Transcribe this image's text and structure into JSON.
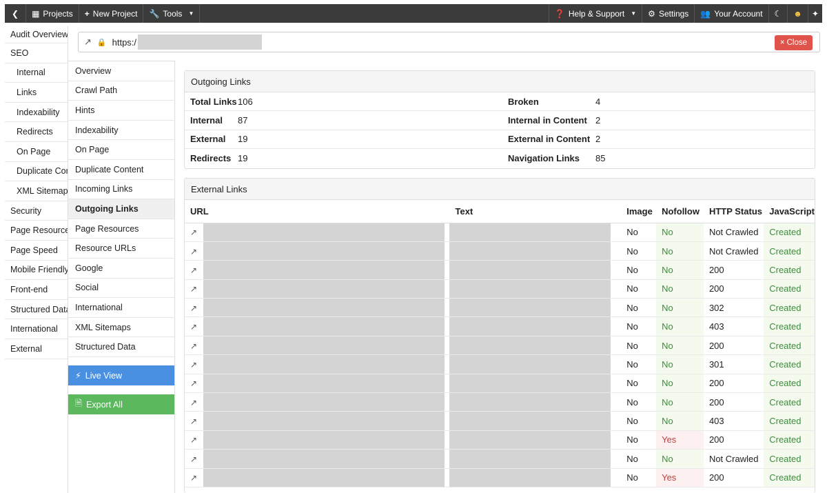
{
  "topbar": {
    "back_icon": "chevron-left-icon",
    "projects": "Projects",
    "new_project": "New Project",
    "tools": "Tools",
    "help": "Help & Support",
    "settings": "Settings",
    "account": "Your Account"
  },
  "sidebar": {
    "items": [
      {
        "label": "Audit Overview",
        "level": "top"
      },
      {
        "label": "SEO",
        "level": "top"
      },
      {
        "label": "Internal",
        "level": "sub"
      },
      {
        "label": "Links",
        "level": "sub"
      },
      {
        "label": "Indexability",
        "level": "sub"
      },
      {
        "label": "Redirects",
        "level": "sub"
      },
      {
        "label": "On Page",
        "level": "sub"
      },
      {
        "label": "Duplicate Content",
        "level": "sub"
      },
      {
        "label": "XML Sitemaps",
        "level": "sub"
      },
      {
        "label": "Security",
        "level": "top"
      },
      {
        "label": "Page Resources",
        "level": "top"
      },
      {
        "label": "Page Speed",
        "level": "top"
      },
      {
        "label": "Mobile Friendly",
        "level": "top"
      },
      {
        "label": "Front-end",
        "level": "top"
      },
      {
        "label": "Structured Data",
        "level": "top"
      },
      {
        "label": "International",
        "level": "top"
      },
      {
        "label": "External",
        "level": "top"
      }
    ]
  },
  "urlbar": {
    "url": "https:/",
    "close_label": "Close"
  },
  "subnav": {
    "items": [
      "Overview",
      "Crawl Path",
      "Hints",
      "Indexability",
      "On Page",
      "Duplicate Content",
      "Incoming Links",
      "Outgoing Links",
      "Page Resources",
      "Resource URLs",
      "Google",
      "Social",
      "International",
      "XML Sitemaps",
      "Structured Data"
    ],
    "active": "Outgoing Links",
    "live_view": "Live View",
    "export_all": "Export All"
  },
  "summary": {
    "title": "Outgoing Links",
    "rows": [
      {
        "l1": "Total Links",
        "v1": "106",
        "l2": "Broken",
        "v2": "4"
      },
      {
        "l1": "Internal",
        "v1": "87",
        "l2": "Internal in Content",
        "v2": "2"
      },
      {
        "l1": "External",
        "v1": "19",
        "l2": "External in Content",
        "v2": "2"
      },
      {
        "l1": "Redirects",
        "v1": "19",
        "l2": "Navigation Links",
        "v2": "85"
      }
    ]
  },
  "external": {
    "title": "External Links",
    "headers": {
      "url": "URL",
      "text": "Text",
      "image": "Image",
      "nofollow": "Nofollow",
      "status": "HTTP Status",
      "js": "JavaScript"
    },
    "rows": [
      {
        "image": "No",
        "nofollow": "No",
        "status": "Not Crawled",
        "js": "Created"
      },
      {
        "image": "No",
        "nofollow": "No",
        "status": "Not Crawled",
        "js": "Created"
      },
      {
        "image": "No",
        "nofollow": "No",
        "status": "200",
        "js": "Created"
      },
      {
        "image": "No",
        "nofollow": "No",
        "status": "200",
        "js": "Created"
      },
      {
        "image": "No",
        "nofollow": "No",
        "status": "302",
        "js": "Created"
      },
      {
        "image": "No",
        "nofollow": "No",
        "status": "403",
        "js": "Created"
      },
      {
        "image": "No",
        "nofollow": "No",
        "status": "200",
        "js": "Created"
      },
      {
        "image": "No",
        "nofollow": "No",
        "status": "301",
        "js": "Created"
      },
      {
        "image": "No",
        "nofollow": "No",
        "status": "200",
        "js": "Created"
      },
      {
        "image": "No",
        "nofollow": "No",
        "status": "200",
        "js": "Created"
      },
      {
        "image": "No",
        "nofollow": "No",
        "status": "403",
        "js": "Created"
      },
      {
        "image": "No",
        "nofollow": "Yes",
        "status": "200",
        "js": "Created"
      },
      {
        "image": "No",
        "nofollow": "No",
        "status": "Not Crawled",
        "js": "Created"
      },
      {
        "image": "No",
        "nofollow": "Yes",
        "status": "200",
        "js": "Created"
      }
    ]
  }
}
